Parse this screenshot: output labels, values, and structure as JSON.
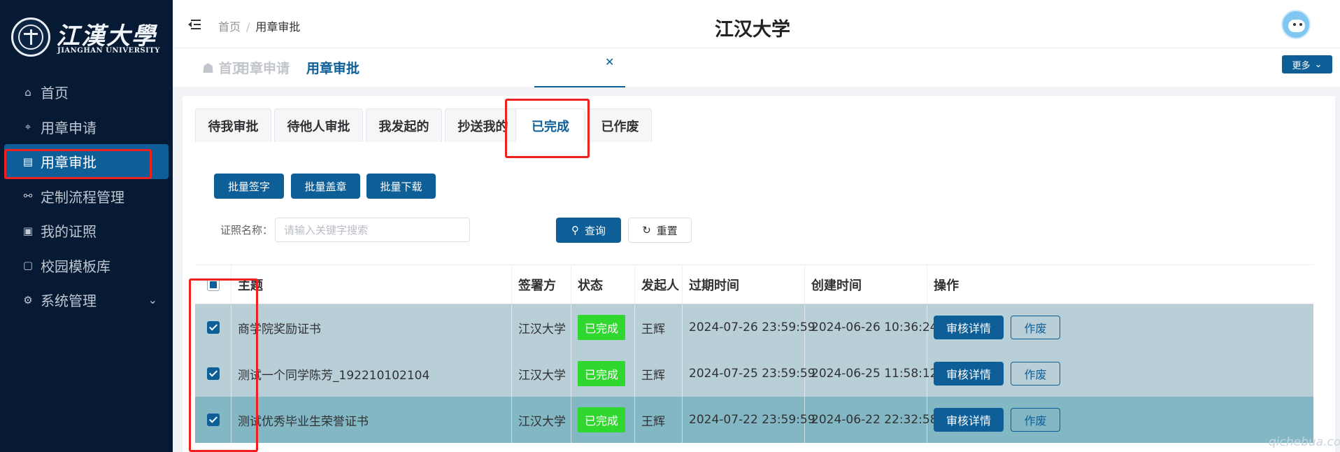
{
  "sidebar": {
    "logo_cn": "江漢大學",
    "logo_en": "JIANGHAN UNIVERSITY",
    "items": [
      {
        "label": "首页",
        "icon": "home-icon"
      },
      {
        "label": "用章申请",
        "icon": "target-icon"
      },
      {
        "label": "用章审批",
        "icon": "approve-doc-icon",
        "active": true
      },
      {
        "label": "定制流程管理",
        "icon": "flow-icon"
      },
      {
        "label": "我的证照",
        "icon": "license-icon"
      },
      {
        "label": "校园模板库",
        "icon": "template-icon"
      },
      {
        "label": "系统管理",
        "icon": "gear-icon",
        "expandable": true
      }
    ]
  },
  "header": {
    "breadcrumb": [
      "首页",
      "/",
      "用章审批"
    ],
    "title": "江汉大学"
  },
  "page_tabs": [
    {
      "label": "首页",
      "icon": "home-icon"
    },
    {
      "label": "用章申请"
    },
    {
      "label": "用章审批",
      "active": true,
      "closable": true
    }
  ],
  "more_button": "更多",
  "sub_tabs": [
    {
      "label": "待我审批"
    },
    {
      "label": "待他人审批"
    },
    {
      "label": "我发起的"
    },
    {
      "label": "抄送我的"
    },
    {
      "label": "已完成",
      "active": true
    },
    {
      "label": "已作废"
    }
  ],
  "batch_actions": [
    "批量签字",
    "批量盖章",
    "批量下载"
  ],
  "filter": {
    "label": "证照名称：",
    "placeholder": "请输入关键字搜索",
    "query_label": "查询",
    "reset_label": "重置"
  },
  "table": {
    "columns": [
      "主题",
      "签署方",
      "状态",
      "发起人",
      "过期时间",
      "创建时间",
      "操作"
    ],
    "rows": [
      {
        "checked": true,
        "subject": "商学院奖励证书",
        "signer": "江汉大学",
        "status": "已完成",
        "initiator": "王辉",
        "expire": "2024-07-26 23:59:59",
        "created": "2024-06-26 10:36:24"
      },
      {
        "checked": true,
        "subject": "测试一个同学陈芳_192210102104",
        "signer": "江汉大学",
        "status": "已完成",
        "initiator": "王辉",
        "expire": "2024-07-25 23:59:59",
        "created": "2024-06-25 11:58:12"
      },
      {
        "checked": true,
        "subject": "测试优秀毕业生荣誉证书",
        "signer": "江汉大学",
        "status": "已完成",
        "initiator": "王辉",
        "expire": "2024-07-22 23:59:59",
        "created": "2024-06-22 22:32:58"
      }
    ],
    "actions": [
      "审核详情",
      "作废"
    ]
  },
  "watermark": "qichebua.com",
  "colors": {
    "sidebar_bg": "#071a33",
    "primary": "#0e5f97",
    "status_done": "#2fd72f",
    "highlight_border": "#ef2020"
  }
}
